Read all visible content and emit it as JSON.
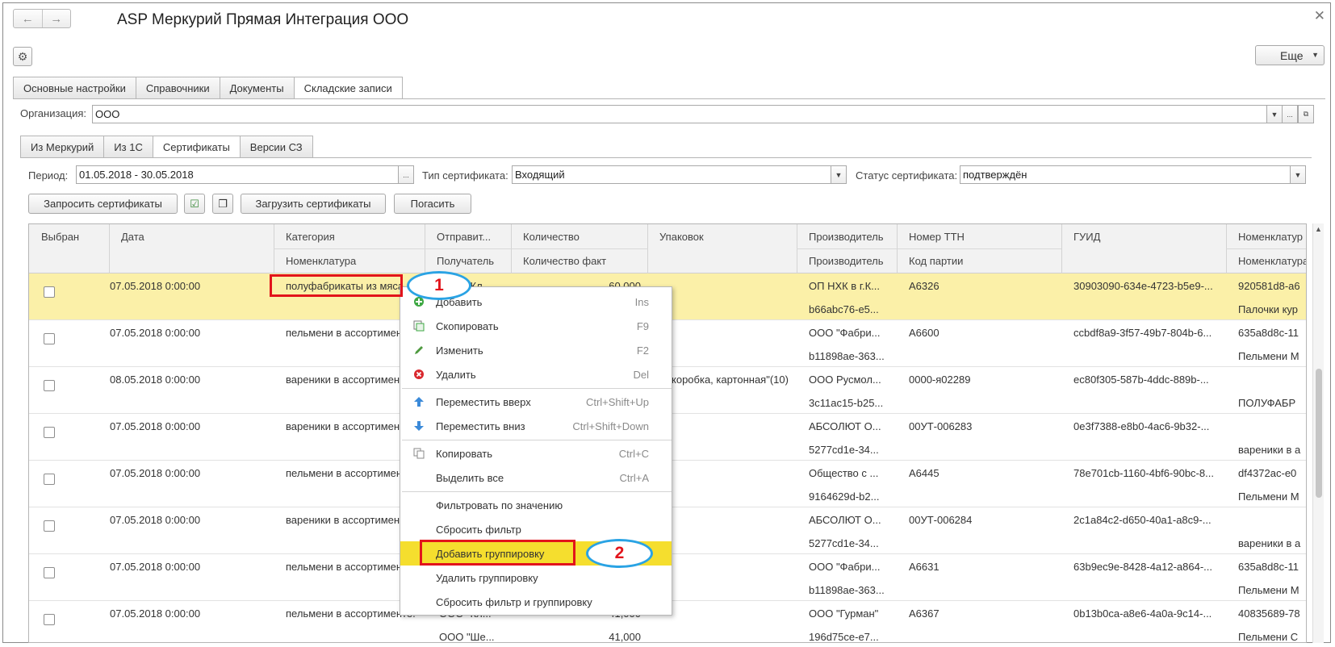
{
  "window": {
    "title": "ASP Меркурий Прямая Интеграция ООО",
    "more_label": "Еще"
  },
  "main_tabs": [
    {
      "label": "Основные настройки"
    },
    {
      "label": "Справочники"
    },
    {
      "label": "Документы"
    },
    {
      "label": "Складские записи"
    }
  ],
  "organization": {
    "label": "Организация:",
    "value": "ООО"
  },
  "sub_tabs": [
    {
      "label": "Из Меркурий"
    },
    {
      "label": "Из 1С"
    },
    {
      "label": "Сертификаты"
    },
    {
      "label": "Версии СЗ"
    }
  ],
  "filters": {
    "period_label": "Период:",
    "period_value": "01.05.2018 - 30.05.2018",
    "type_label": "Тип сертификата:",
    "type_value": "Входящий",
    "status_label": "Статус сертификата:",
    "status_value": "подтверждён"
  },
  "toolbar": {
    "request_label": "Запросить сертификаты",
    "load_label": "Загрузить сертификаты",
    "redeem_label": "Погасить"
  },
  "columns": {
    "selected": "Выбран",
    "date": "Дата",
    "category": "Категория",
    "nomenclature": "Номенклатура",
    "sender": "Отправит...",
    "receiver": "Получатель",
    "quantity": "Количество",
    "quantity_fact": "Количество факт",
    "package": "Упаковок",
    "producer1": "Производитель",
    "producer2": "Производитель",
    "ttn": "Номер ТТН",
    "batch": "Код партии",
    "guid": "ГУИД",
    "nomen1": "Номенклатур",
    "nomen2": "Номенклатура"
  },
  "rows": [
    {
      "date": "07.05.2018 0:00:00",
      "category": "полуфабрикаты из мяса",
      "sender": "ООО \"Кл...",
      "quantity": "60,000",
      "package": "",
      "producer": "ОП НХК в г.К...",
      "producer2": "b66abc76-e5...",
      "ttn": "А6326",
      "guid": "30903090-634e-4723-b5e9-...",
      "n1": "920581d8-a6",
      "n2": "Палочки кур"
    },
    {
      "date": "07.05.2018 0:00:00",
      "category": "пельмени в ассортименте",
      "sender": "",
      "quantity": "",
      "package": "",
      "producer": "ООО \"Фабри...",
      "producer2": "b11898ae-363...",
      "ttn": "А6600",
      "guid": "ccbdf8a9-3f57-49b7-804b-6...",
      "n1": "635a8d8c-11",
      "n2": "Пельмени М"
    },
    {
      "date": "08.05.2018 0:00:00",
      "category": "вареники в ассортименте",
      "sender": "",
      "quantity": "",
      "package": "коробка, картонная\"(10)",
      "producer": "ООО Русмол...",
      "producer2": "3c11ac15-b25...",
      "ttn": "0000-я02289",
      "guid": "ec80f305-587b-4ddc-889b-...",
      "n1": "",
      "n2": "ПОЛУФАБР"
    },
    {
      "date": "07.05.2018 0:00:00",
      "category": "вареники в ассортименте",
      "sender": "",
      "quantity": "",
      "package": "",
      "producer": "АБСОЛЮТ О...",
      "producer2": "5277cd1e-34...",
      "ttn": "00УТ-006283",
      "guid": "0e3f7388-e8b0-4ac6-9b32-...",
      "n1": "",
      "n2": "вареники в а"
    },
    {
      "date": "07.05.2018 0:00:00",
      "category": "пельмени в ассортименте",
      "sender": "",
      "quantity": "",
      "package": "",
      "producer": "Общество с ...",
      "producer2": "9164629d-b2...",
      "ttn": "А6445",
      "guid": "78e701cb-1160-4bf6-90bc-8...",
      "n1": "df4372ac-e0",
      "n2": "Пельмени М"
    },
    {
      "date": "07.05.2018 0:00:00",
      "category": "вареники в ассортименте",
      "sender": "",
      "quantity": "",
      "package": "",
      "producer": "АБСОЛЮТ О...",
      "producer2": "5277cd1e-34...",
      "ttn": "00УТ-006284",
      "guid": "2c1a84c2-d650-40a1-a8c9-...",
      "n1": "",
      "n2": "вареники в а"
    },
    {
      "date": "07.05.2018 0:00:00",
      "category": "пельмени в ассортименте",
      "sender": "",
      "quantity": "",
      "package": "",
      "producer": "ООО \"Фабри...",
      "producer2": "b11898ae-363...",
      "ttn": "А6631",
      "guid": "63b9ec9e-8428-4a12-a864-...",
      "n1": "635a8d8c-11",
      "n2": "Пельмени М"
    },
    {
      "date": "07.05.2018 0:00:00",
      "category": "пельмени в ассортименте...",
      "sender": "ООО \"Кл...",
      "quantity": "41,000",
      "receiver": "ООО \"Ше...",
      "quantity_fact": "41,000",
      "package": "",
      "producer": "ООО \"Гурман\"",
      "producer2": "196d75ce-e7...",
      "ttn": "А6367",
      "guid": "0b13b0ca-a8e6-4a0a-9c14-...",
      "n1": "40835689-78",
      "n2": "Пельмени С"
    }
  ],
  "context_menu": {
    "add": "Добавить",
    "add_sc": "Ins",
    "copy": "Скопировать",
    "copy_sc": "F9",
    "edit": "Изменить",
    "edit_sc": "F2",
    "delete": "Удалить",
    "delete_sc": "Del",
    "move_up": "Переместить вверх",
    "move_up_sc": "Ctrl+Shift+Up",
    "move_down": "Переместить вниз",
    "move_down_sc": "Ctrl+Shift+Down",
    "clip_copy": "Копировать",
    "clip_copy_sc": "Ctrl+C",
    "select_all": "Выделить все",
    "select_all_sc": "Ctrl+A",
    "filter_by_value": "Фильтровать по значению",
    "reset_filter": "Сбросить фильтр",
    "add_grouping": "Добавить группировку",
    "remove_grouping": "Удалить группировку",
    "reset_all": "Сбросить фильтр и группировку"
  },
  "annotations": {
    "marker_1": "1",
    "marker_2": "2"
  },
  "colors": {
    "highlight": "#f5de2e",
    "selected_row": "#fbf0a8",
    "annotation_red": "#e2141b",
    "annotation_blue": "#2aa3e4"
  }
}
